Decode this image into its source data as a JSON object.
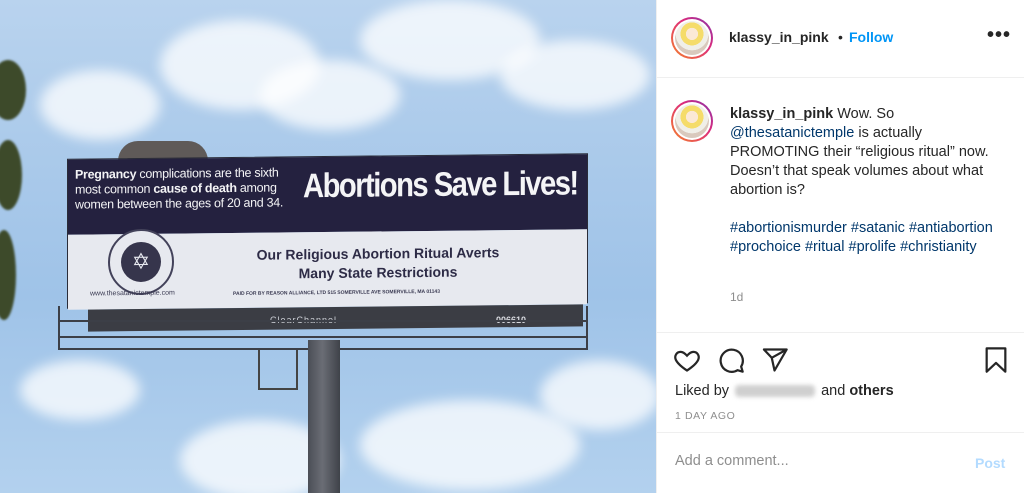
{
  "photo": {
    "billboard": {
      "fact_parts": [
        "Pregnancy",
        " complications are the sixth most common ",
        "cause of death",
        " among women between the ages of 20 and 34."
      ],
      "headline": "Abortions Save Lives!",
      "body_line1": "Our Religious Abortion Ritual Averts",
      "body_line2": "Many State Restrictions",
      "url": "www.thesatanictemple.com",
      "paid_for": "PAID FOR BY REASON ALLIANCE, LTD 515 SOMERVILLE AVE SOMERVILLE, MA 01143",
      "ledge_brand": "ClearChannel",
      "ledge_number": "006610"
    }
  },
  "header": {
    "username": "klassy_in_pink",
    "dot": "•",
    "follow_label": "Follow",
    "more_label": "•••"
  },
  "caption": {
    "username": "klassy_in_pink",
    "text_part1": " Wow. So ",
    "mention": "@thesatanictemple",
    "text_part2": " is actually PROMOTING their “religious ritual” now. Doesn’t that speak volumes about what abortion is?",
    "hashtags": [
      "#abortionismurder",
      "#satanic",
      "#antiabortion",
      "#prochoice",
      "#ritual",
      "#prolife",
      "#christianity"
    ],
    "time": "1d"
  },
  "actions": {
    "liked_prefix": "Liked by",
    "liked_suffix": "and",
    "liked_others": "others",
    "date": "1 DAY AGO"
  },
  "comment": {
    "placeholder": "Add a comment...",
    "post_label": "Post"
  },
  "colors": {
    "follow": "#0095f6",
    "link": "#00376b",
    "post_disabled": "#b3dbff",
    "billboard_band": "#24213f"
  },
  "icons": [
    "heart-icon",
    "comment-icon",
    "share-icon",
    "bookmark-icon",
    "more-icon"
  ]
}
